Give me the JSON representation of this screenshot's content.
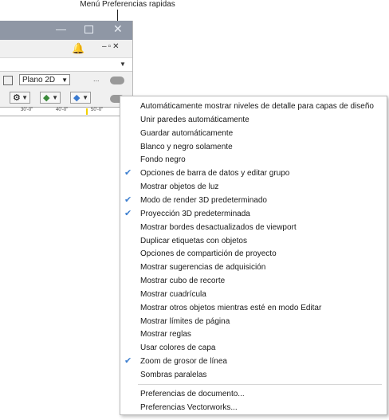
{
  "callout": {
    "text": "Menú Preferencias rapidas"
  },
  "toolbar": {
    "view_dropdown": "Plano 2D",
    "dots": "...",
    "ruler_ticks": [
      "30'-0\"",
      "40'-0\"",
      "50'-0\""
    ]
  },
  "menu": {
    "items": [
      {
        "label": "Automáticamente mostrar niveles de detalle para capas de diseño",
        "checked": false
      },
      {
        "label": "Unir paredes automáticamente",
        "checked": false
      },
      {
        "label": "Guardar automáticamente",
        "checked": false
      },
      {
        "label": "Blanco y negro solamente",
        "checked": false
      },
      {
        "label": "Fondo negro",
        "checked": false
      },
      {
        "label": "Opciones de barra de datos y editar grupo",
        "checked": true
      },
      {
        "label": "Mostrar objetos de luz",
        "checked": false
      },
      {
        "label": "Modo de render 3D predeterminado",
        "checked": true
      },
      {
        "label": "Proyección 3D predeterminada",
        "checked": true
      },
      {
        "label": "Mostrar bordes desactualizados de viewport",
        "checked": false
      },
      {
        "label": "Duplicar etiquetas con objetos",
        "checked": false
      },
      {
        "label": "Opciones de compartición de proyecto",
        "checked": false
      },
      {
        "label": "Mostrar sugerencias de adquisición",
        "checked": false
      },
      {
        "label": "Mostrar cubo de recorte",
        "checked": false
      },
      {
        "label": "Mostrar cuadrícula",
        "checked": false
      },
      {
        "label": "Mostrar otros objetos mientras esté en modo Editar",
        "checked": false
      },
      {
        "label": "Mostrar límites de página",
        "checked": false
      },
      {
        "label": "Mostrar reglas",
        "checked": false
      },
      {
        "label": "Usar colores de capa",
        "checked": false
      },
      {
        "label": "Zoom de grosor de línea",
        "checked": true
      },
      {
        "label": "Sombras paralelas",
        "checked": false
      }
    ],
    "footer_items": [
      {
        "label": "Preferencias de documento..."
      },
      {
        "label": "Preferencias Vectorworks..."
      }
    ]
  },
  "colors": {
    "check": "#3d7fd0",
    "titlebar": "#8f97a5"
  }
}
